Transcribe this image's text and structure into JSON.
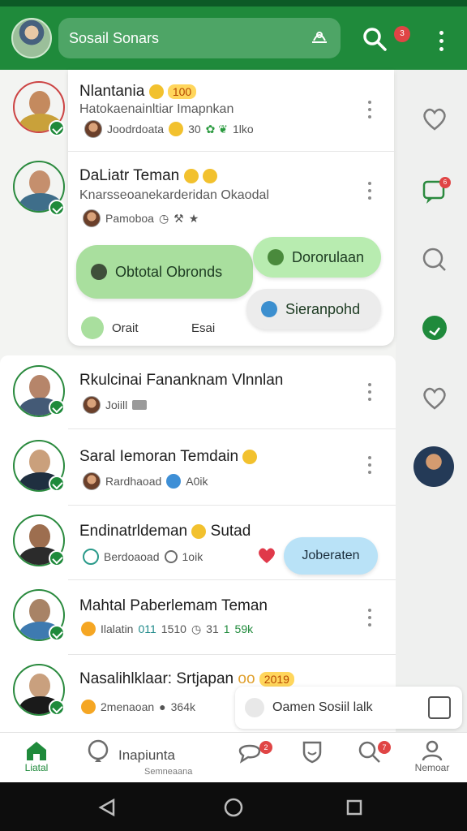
{
  "header": {
    "title": "Sosail Sonars",
    "notification_count": "3",
    "search_icon": "search-icon",
    "more_icon": "more-vertical-icon"
  },
  "feed_top": [
    {
      "name": "Nlantania",
      "name_tag": "100",
      "subtitle": "Hatokaenainltiar Imapnkan",
      "meta_author": "Joodrdoata",
      "meta_count": "30",
      "meta_extra": "1lko"
    },
    {
      "name": "DaLiatr Teman",
      "subtitle": "Knarsseoanekarderidan Okaodal",
      "meta_author": "Pamoboa"
    }
  ],
  "bubbles": {
    "obtotal": "Obtotal Obronds",
    "dororulaan": "Dororulaan",
    "sieranpohd": "Sieranpohd",
    "orait": "Orait",
    "esai": "Esai"
  },
  "feed_list": [
    {
      "name": "Rkulcinai Fananknam Vlnnlan",
      "meta_author": "Joiill"
    },
    {
      "name": "Saral Iemoran Temdain",
      "meta_author": "Rardhaoad",
      "meta_extra": "A0ik"
    },
    {
      "name": "Endinatrldeman",
      "name_suffix": "Sutad",
      "meta_author": "Berdoaoad",
      "meta_extra": "1oik",
      "bubble": "Joberaten"
    },
    {
      "name": "Mahtal Paberlemam Teman",
      "meta_author": "Ilalatin",
      "meta_count_a": "011",
      "meta_count_b": "1510",
      "meta_count_c": "31",
      "meta_count_d": "1",
      "meta_count_e": "59k"
    },
    {
      "name": "Nasalihlklaar: Srtjapan",
      "name_tag": "2019",
      "name_tag_prefix": "oo",
      "meta_author": "2menaoan",
      "meta_extra": "364k"
    }
  ],
  "social_bar": {
    "text": "Oamen Sosiil lalk"
  },
  "strip_badges": {
    "chat": "6"
  },
  "bottom_nav": {
    "home": "Liatal",
    "inspiration": "Inapiunta",
    "inspiration_sub": "Semneaana",
    "chat_badge": "2",
    "search_badge": "7",
    "profile": "Nemoar"
  },
  "colors": {
    "primary": "#1f8a3b",
    "header_pill": "#4ea566",
    "badge": "#e04545"
  }
}
